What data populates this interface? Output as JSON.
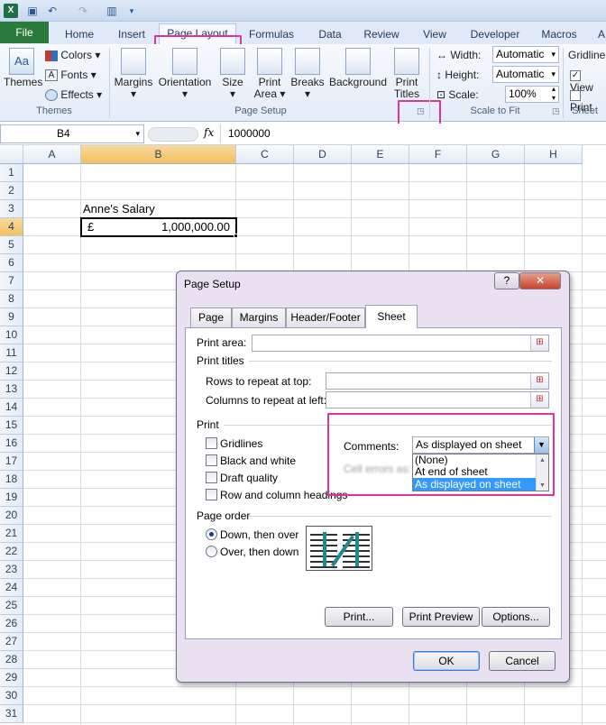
{
  "quick_access": {
    "save_icon": "save-icon",
    "undo_icon": "undo-icon",
    "redo_icon": "redo-icon",
    "chart_icon": "chart-icon"
  },
  "tabs": [
    "File",
    "Home",
    "Insert",
    "Page Layout",
    "Formulas",
    "Data",
    "Review",
    "View",
    "Developer",
    "Macros",
    "A"
  ],
  "active_tab": "Page Layout",
  "ribbon": {
    "themes": {
      "themes_label": "Themes",
      "colors": "Colors",
      "fonts": "Fonts",
      "effects": "Effects",
      "group": "Themes"
    },
    "page_setup": {
      "margins": "Margins",
      "orientation": "Orientation",
      "size": "Size",
      "print_area_1": "Print",
      "print_area_2": "Area",
      "breaks": "Breaks",
      "background": "Background",
      "print_titles_1": "Print",
      "print_titles_2": "Titles",
      "group": "Page Setup"
    },
    "scale": {
      "width_label": "Width:",
      "width_value": "Automatic",
      "height_label": "Height:",
      "height_value": "Automatic",
      "scale_label": "Scale:",
      "scale_value": "100%",
      "group": "Scale to Fit"
    },
    "sheet_opts": {
      "gridlines": "Gridline",
      "view": "View",
      "print": "Print",
      "group": "Sheet"
    }
  },
  "formula_bar": {
    "name_box": "B4",
    "fx": "fx",
    "value": "1000000"
  },
  "grid": {
    "columns": [
      "A",
      "B",
      "C",
      "D",
      "E",
      "F",
      "G",
      "H"
    ],
    "rows": [
      "1",
      "2",
      "3",
      "4",
      "5",
      "6",
      "7",
      "8",
      "9",
      "10",
      "11",
      "12",
      "13",
      "14",
      "15",
      "16",
      "17",
      "18",
      "19",
      "20",
      "21",
      "22",
      "23",
      "24",
      "25",
      "26",
      "27",
      "28",
      "29",
      "30",
      "31"
    ],
    "b3": "Anne's Salary",
    "b4_currency": "£",
    "b4_value": "1,000,000.00"
  },
  "dialog": {
    "title": "Page Setup",
    "help": "?",
    "close": "✕",
    "tabs": [
      "Page",
      "Margins",
      "Header/Footer",
      "Sheet"
    ],
    "print_area": "Print area:",
    "print_titles": "Print titles",
    "rows_repeat": "Rows to repeat at top:",
    "cols_repeat": "Columns to repeat at left:",
    "print_section": "Print",
    "gridlines": "Gridlines",
    "black_white": "Black and white",
    "draft": "Draft quality",
    "row_col_headings": "Row and column headings",
    "comments_label": "Comments:",
    "comments_value": "As displayed on sheet",
    "cell_errors_label": "Cell errors as:",
    "comment_options": [
      "(None)",
      "At end of sheet",
      "As displayed on sheet"
    ],
    "page_order": "Page order",
    "down_over": "Down, then over",
    "over_down": "Over, then down",
    "print_btn": "Print...",
    "print_preview_btn": "Print Preview",
    "options_btn": "Options...",
    "ok": "OK",
    "cancel": "Cancel"
  }
}
